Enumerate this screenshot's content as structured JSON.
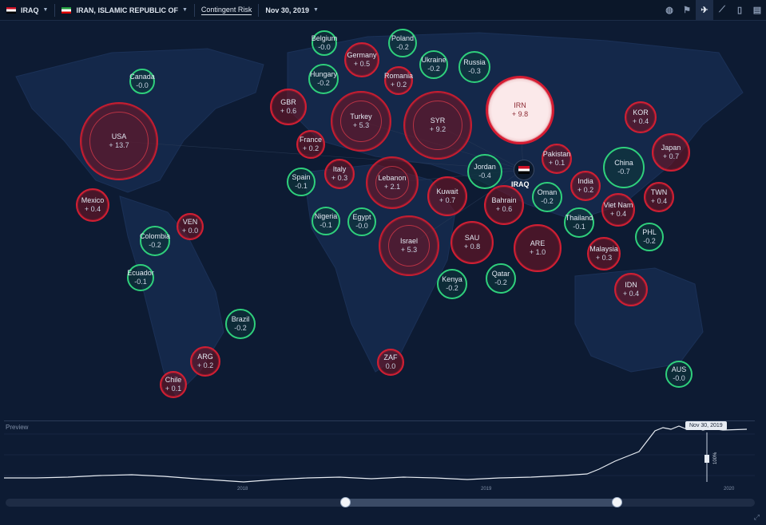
{
  "toolbar": {
    "country": "IRAQ",
    "partner": "IRAN, ISLAMIC REPUBLIC OF",
    "tab": "Contingent Risk",
    "date": "Nov 30, 2019"
  },
  "toolbar_icons": [
    "globe-icon",
    "flag-icon",
    "plane-icon",
    "line-chart-icon",
    "bookmark-icon",
    "document-icon"
  ],
  "colors": {
    "positive": "#d11f33",
    "negative": "#2fd07c",
    "background": "#0d1b33"
  },
  "focus": {
    "label": "IRAQ"
  },
  "bubbles": [
    {
      "name": "Canada",
      "value": "-0.0",
      "type": "neg"
    },
    {
      "name": "USA",
      "value": "+ 13.7",
      "type": "pos"
    },
    {
      "name": "Mexico",
      "value": "+ 0.4",
      "type": "pos"
    },
    {
      "name": "VEN",
      "value": "+ 0.0",
      "type": "pos"
    },
    {
      "name": "Colombia",
      "value": "-0.2",
      "type": "neg"
    },
    {
      "name": "Ecuador",
      "value": "-0.1",
      "type": "neg"
    },
    {
      "name": "Brazil",
      "value": "-0.2",
      "type": "neg"
    },
    {
      "name": "ARG",
      "value": "+ 0.2",
      "type": "pos"
    },
    {
      "name": "Chile",
      "value": "+ 0.1",
      "type": "pos"
    },
    {
      "name": "Belgium",
      "value": "-0.0",
      "type": "neg"
    },
    {
      "name": "Poland",
      "value": "-0.2",
      "type": "neg"
    },
    {
      "name": "Germany",
      "value": "+ 0.5",
      "type": "pos"
    },
    {
      "name": "Ukraine",
      "value": "-0.2",
      "type": "neg"
    },
    {
      "name": "Russia",
      "value": "-0.3",
      "type": "neg"
    },
    {
      "name": "Hungary",
      "value": "-0.2",
      "type": "neg"
    },
    {
      "name": "Romania",
      "value": "+ 0.2",
      "type": "pos"
    },
    {
      "name": "GBR",
      "value": "+ 0.6",
      "type": "pos"
    },
    {
      "name": "Turkey",
      "value": "+ 5.3",
      "type": "pos"
    },
    {
      "name": "SYR",
      "value": "+ 9.2",
      "type": "pos"
    },
    {
      "name": "IRN",
      "value": "+ 9.8",
      "type": "pos"
    },
    {
      "name": "France",
      "value": "+ 0.2",
      "type": "pos"
    },
    {
      "name": "Spain",
      "value": "-0.1",
      "type": "neg"
    },
    {
      "name": "Italy",
      "value": "+ 0.3",
      "type": "pos"
    },
    {
      "name": "Lebanon",
      "value": "+ 2.1",
      "type": "pos"
    },
    {
      "name": "Jordan",
      "value": "-0.4",
      "type": "neg"
    },
    {
      "name": "Pakistan",
      "value": "+ 0.1",
      "type": "pos"
    },
    {
      "name": "KOR",
      "value": "+ 0.4",
      "type": "pos"
    },
    {
      "name": "China",
      "value": "-0.7",
      "type": "neg"
    },
    {
      "name": "Japan",
      "value": "+ 0.7",
      "type": "pos"
    },
    {
      "name": "Kuwait",
      "value": "+ 0.7",
      "type": "pos"
    },
    {
      "name": "Bahrain",
      "value": "+ 0.6",
      "type": "pos"
    },
    {
      "name": "Oman",
      "value": "-0.2",
      "type": "neg"
    },
    {
      "name": "India",
      "value": "+ 0.2",
      "type": "pos"
    },
    {
      "name": "TWN",
      "value": "+ 0.4",
      "type": "pos"
    },
    {
      "name": "Nigeria",
      "value": "-0.1",
      "type": "neg"
    },
    {
      "name": "Egypt",
      "value": "-0.0",
      "type": "neg"
    },
    {
      "name": "Israel",
      "value": "+ 5.3",
      "type": "pos"
    },
    {
      "name": "SAU",
      "value": "+ 0.8",
      "type": "pos"
    },
    {
      "name": "ARE",
      "value": "+ 1.0",
      "type": "pos"
    },
    {
      "name": "Thailand",
      "value": "-0.1",
      "type": "neg"
    },
    {
      "name": "Viet Nam",
      "value": "+ 0.4",
      "type": "pos"
    },
    {
      "name": "PHL",
      "value": "-0.2",
      "type": "neg"
    },
    {
      "name": "Malaysia",
      "value": "+ 0.3",
      "type": "pos"
    },
    {
      "name": "Kenya",
      "value": "-0.2",
      "type": "neg"
    },
    {
      "name": "Qatar",
      "value": "-0.2",
      "type": "neg"
    },
    {
      "name": "IDN",
      "value": "+ 0.4",
      "type": "pos"
    },
    {
      "name": "ZAF",
      "value": "0.0",
      "type": "pos"
    },
    {
      "name": "AUS",
      "value": "-0.0",
      "type": "neg"
    }
  ],
  "preview": {
    "label": "Preview",
    "tooltip": "Nov 30, 2019",
    "years": [
      "2018",
      "2019",
      "2020"
    ],
    "vertical_label": "100%"
  }
}
